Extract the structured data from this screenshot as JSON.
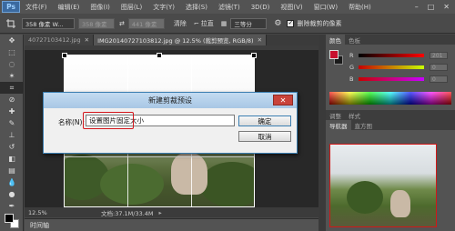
{
  "app": {
    "logo": "Ps",
    "menu": [
      "文件(F)",
      "编辑(E)",
      "图像(I)",
      "图层(L)",
      "文字(Y)",
      "选择(S)",
      "滤镜(T)",
      "3D(D)",
      "视图(V)",
      "窗口(W)",
      "帮助(H)"
    ],
    "window_controls": [
      "–",
      "□",
      "✕"
    ]
  },
  "options": {
    "ratio_select": "358 像素 W...",
    "width_value": "358 像素",
    "height_value": "441 像素",
    "clear_label": "清除",
    "straighten_label": "拉直",
    "view_select": "三等分",
    "delete_cropped_label": "删除裁剪的像素"
  },
  "doc_tabs": [
    {
      "label": "40727103412.jpg",
      "active": false
    },
    {
      "label": "IMG20140727103812.jpg @ 12.5% (裁剪预览, RGB/8)",
      "active": true
    }
  ],
  "status": {
    "zoom": "12.5%",
    "doc_info": "文档:37.1M/33.4M"
  },
  "timeline": {
    "label": "时间轴"
  },
  "color_panel": {
    "tabs": [
      "颜色",
      "色板"
    ],
    "sliders": [
      {
        "label": "R",
        "value": "201"
      },
      {
        "label": "G",
        "value": "0"
      },
      {
        "label": "B",
        "value": "0"
      }
    ],
    "fg_color": "#c8102e"
  },
  "nav_panel": {
    "tabs_top": [
      "调整",
      "样式"
    ],
    "tabs": [
      "导航器",
      "直方图"
    ]
  },
  "dialog": {
    "title": "新建剪裁预设",
    "close": "✕",
    "name_label": "名称(N):",
    "name_value": "设置图片固定大小",
    "ok_label": "确定",
    "cancel_label": "取消"
  },
  "accent_color": "#d3161b"
}
